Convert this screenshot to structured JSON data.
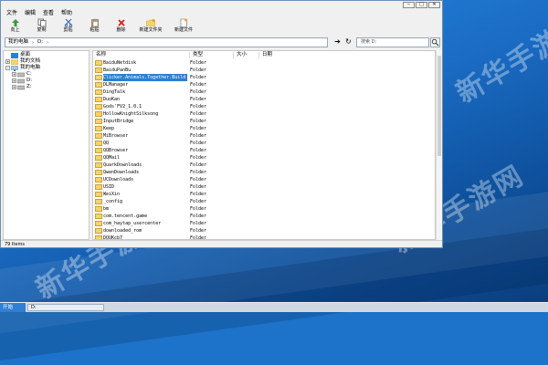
{
  "menubar": [
    "文件",
    "编辑",
    "查看",
    "帮助"
  ],
  "toolbar": [
    {
      "label": "向上",
      "icon": "up-arrow-icon"
    },
    {
      "label": "复制",
      "icon": "copy-icon"
    },
    {
      "label": "剪贴",
      "icon": "cut-icon"
    },
    {
      "label": "粘贴",
      "icon": "paste-icon"
    },
    {
      "label": "删除",
      "icon": "delete-icon"
    },
    {
      "label": "新建文件夹",
      "icon": "new-folder-icon"
    },
    {
      "label": "新建文件",
      "icon": "new-file-icon"
    }
  ],
  "address": {
    "crumbs": [
      "我的电脑",
      "D:"
    ],
    "search_placeholder": "搜索 D:"
  },
  "tree": [
    {
      "label": "桌面",
      "icon": "desktop-icon",
      "expander": ""
    },
    {
      "label": "我的文档",
      "icon": "documents-icon",
      "expander": "+"
    },
    {
      "label": "我的电脑",
      "icon": "computer-icon",
      "expander": "-"
    },
    {
      "label": "C:",
      "icon": "drive-icon",
      "expander": "+"
    },
    {
      "label": "D:",
      "icon": "drive-icon",
      "expander": "+"
    },
    {
      "label": "Z:",
      "icon": "drive-icon",
      "expander": "+"
    }
  ],
  "columns": [
    "名称",
    "类型",
    "大小",
    "日期"
  ],
  "files": [
    {
      "name": "BaiduNetdisk",
      "type": "Folder"
    },
    {
      "name": "BaiduPanBu",
      "type": "Folder"
    },
    {
      "name": "Clicker.Animals.Together.Build",
      "type": "Folder",
      "selected": true
    },
    {
      "name": "DLManager",
      "type": "Folder"
    },
    {
      "name": "DingTalk",
      "type": "Folder"
    },
    {
      "name": "DuoKan",
      "type": "Folder"
    },
    {
      "name": "Gods'FV2_1.0.1",
      "type": "Folder"
    },
    {
      "name": "HollowKnightSilksong",
      "type": "Folder"
    },
    {
      "name": "InputBridge",
      "type": "Folder"
    },
    {
      "name": "Keep",
      "type": "Folder"
    },
    {
      "name": "MiBrowser",
      "type": "Folder"
    },
    {
      "name": "QQ",
      "type": "Folder"
    },
    {
      "name": "QQBrowser",
      "type": "Folder"
    },
    {
      "name": "QQMail",
      "type": "Folder"
    },
    {
      "name": "QuarkDownloads",
      "type": "Folder"
    },
    {
      "name": "QwenDownloads",
      "type": "Folder"
    },
    {
      "name": "UCDownloads",
      "type": "Folder"
    },
    {
      "name": "USID",
      "type": "Folder"
    },
    {
      "name": "WeiXin",
      "type": "Folder"
    },
    {
      "name": "_config",
      "type": "Folder"
    },
    {
      "name": "bm",
      "type": "Folder"
    },
    {
      "name": "com.tencent.game",
      "type": "Folder"
    },
    {
      "name": "com_haytap_usercenter",
      "type": "Folder"
    },
    {
      "name": "downloaded_rom",
      "type": "Folder"
    },
    {
      "name": "DOUKcb7",
      "type": "Folder"
    }
  ],
  "status": "79 Items",
  "taskbar": {
    "start": "开始",
    "item": "D:"
  },
  "watermark": "新华手游网",
  "colors": {
    "selection": "#2b7fd1",
    "folder": "#f5d46f",
    "desktop": "#1a6bc3"
  }
}
